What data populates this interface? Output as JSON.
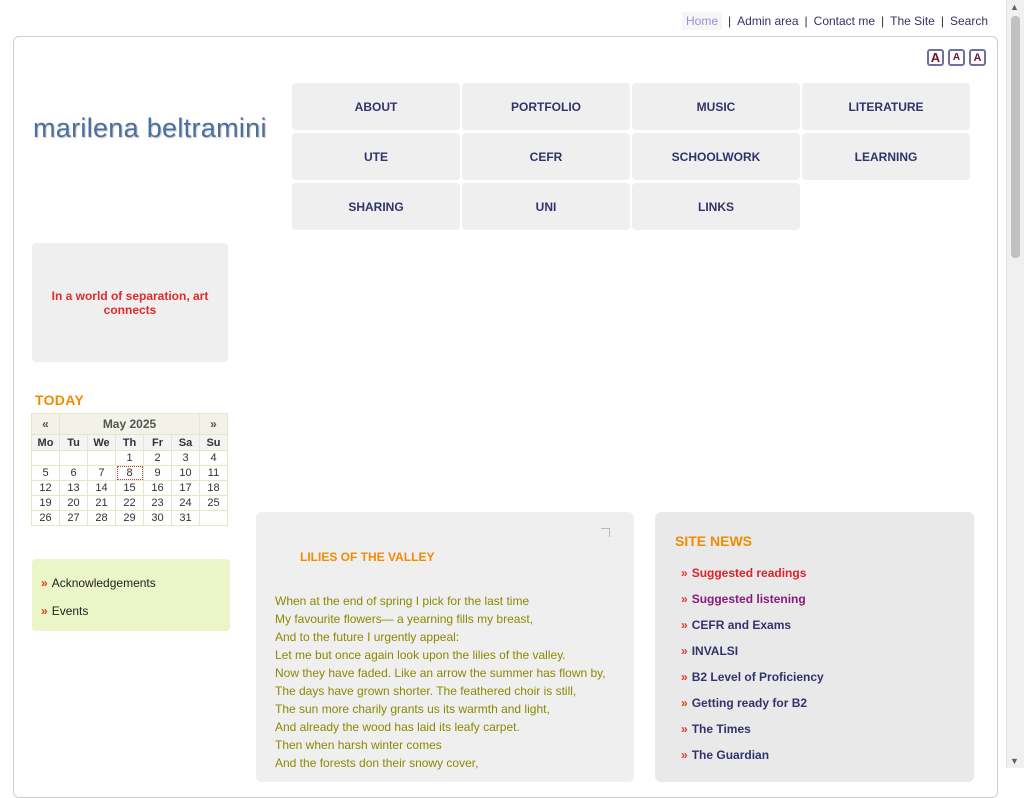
{
  "topnav": {
    "home": "Home",
    "admin": "Admin area",
    "contact": "Contact me",
    "site": "The Site",
    "search": "Search",
    "separator": "|"
  },
  "font_size_controls": [
    "A",
    "A",
    "A"
  ],
  "logo": {
    "text": "marilena beltramini"
  },
  "menu": [
    "ABOUT",
    "PORTFOLIO",
    "MUSIC",
    "LITERATURE",
    "UTE",
    "CEFR",
    "SCHOOLWORK",
    "LEARNING",
    "SHARING",
    "UNI",
    "LINKS"
  ],
  "quote": {
    "text": "In a world of separation, art connects",
    "color": "#e02b2b"
  },
  "today": {
    "label": "TODAY"
  },
  "calendar": {
    "prev": "«",
    "next": "»",
    "month": "May 2025",
    "days": [
      "Mo",
      "Tu",
      "We",
      "Th",
      "Fr",
      "Sa",
      "Su"
    ],
    "weeks": [
      [
        "",
        "",
        "",
        "1",
        "2",
        "3",
        "4"
      ],
      [
        "5",
        "6",
        "7",
        "8",
        "9",
        "10",
        "11"
      ],
      [
        "12",
        "13",
        "14",
        "15",
        "16",
        "17",
        "18"
      ],
      [
        "19",
        "20",
        "21",
        "22",
        "23",
        "24",
        "25"
      ],
      [
        "26",
        "27",
        "28",
        "29",
        "30",
        "31",
        ""
      ]
    ],
    "today": "8"
  },
  "sidelinks": [
    "Acknowledgements",
    "Events"
  ],
  "poem": {
    "title": "LILIES OF THE VALLEY",
    "lines": [
      "When at the end of spring I pick for the last time",
      "My favourite flowers— a yearning fills my breast,",
      "And to the future I urgently appeal:",
      "Let me but once again look upon the lilies of the valley.",
      "Now they have faded. Like an arrow the summer has flown by,",
      "The days have grown shorter. The feathered choir is still,",
      "The sun more charily grants us its warmth and light,",
      "And already the wood has laid its leafy carpet.",
      "Then when harsh winter comes",
      "And the forests don their snowy cover,"
    ]
  },
  "site_news": {
    "title": "SITE NEWS",
    "items": [
      {
        "label": "Suggested readings",
        "color": "#e0202a"
      },
      {
        "label": "Suggested listening",
        "color": "#8a1a7a"
      },
      {
        "label": "CEFR and Exams",
        "color": "#33336b"
      },
      {
        "label": "INVALSI",
        "color": "#33336b"
      },
      {
        "label": "B2 Level of Proficiency",
        "color": "#33336b"
      },
      {
        "label": "Getting ready for B2",
        "color": "#33336b"
      },
      {
        "label": "The Times",
        "color": "#33336b"
      },
      {
        "label": "The Guardian",
        "color": "#33336b"
      }
    ]
  },
  "colors": {
    "accent": "#f08c00",
    "link": "#33336b",
    "arrow": "#e03a1e"
  }
}
